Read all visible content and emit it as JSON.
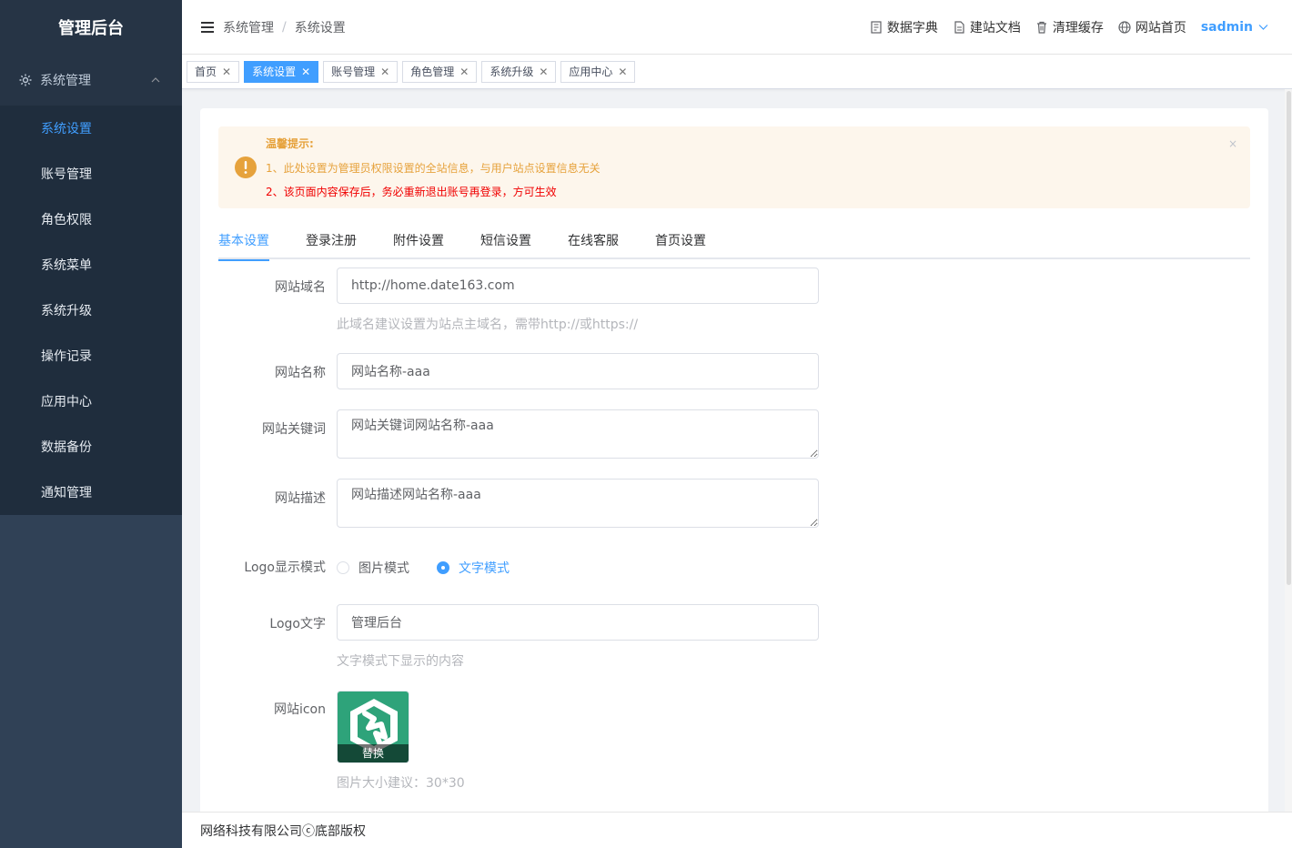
{
  "sidebar": {
    "logo": "管理后台",
    "group_label": "系统管理",
    "items": [
      {
        "label": "系统设置"
      },
      {
        "label": "账号管理"
      },
      {
        "label": "角色权限"
      },
      {
        "label": "系统菜单"
      },
      {
        "label": "系统升级"
      },
      {
        "label": "操作记录"
      },
      {
        "label": "应用中心"
      },
      {
        "label": "数据备份"
      },
      {
        "label": "通知管理"
      }
    ]
  },
  "header": {
    "breadcrumb": [
      "系统管理",
      "系统设置"
    ],
    "breadcrumb_sep": "/",
    "links": [
      {
        "label": "数据字典",
        "icon": "dictionary-icon"
      },
      {
        "label": "建站文档",
        "icon": "document-icon"
      },
      {
        "label": "清理缓存",
        "icon": "trash-icon"
      },
      {
        "label": "网站首页",
        "icon": "globe-icon"
      }
    ],
    "user": "sadmin"
  },
  "tags": [
    {
      "label": "首页"
    },
    {
      "label": "系统设置",
      "active": true
    },
    {
      "label": "账号管理"
    },
    {
      "label": "角色管理"
    },
    {
      "label": "系统升级"
    },
    {
      "label": "应用中心"
    }
  ],
  "alert": {
    "title": "温馨提示:",
    "line1": "1、此处设置为管理员权限设置的全站信息，与用户站点设置信息无关",
    "line2": "2、该页面内容保存后，务必重新退出账号再登录，方可生效",
    "close": "×"
  },
  "tabs": [
    {
      "label": "基本设置",
      "active": true
    },
    {
      "label": "登录注册"
    },
    {
      "label": "附件设置"
    },
    {
      "label": "短信设置"
    },
    {
      "label": "在线客服"
    },
    {
      "label": "首页设置"
    }
  ],
  "form": {
    "domain_label": "网站域名",
    "domain_value": "http://home.date163.com",
    "domain_hint": "此域名建议设置为站点主域名，需带http://或https://",
    "name_label": "网站名称",
    "name_value": "网站名称-aaa",
    "keywords_label": "网站关键词",
    "keywords_value": "网站关键词网站名称-aaa",
    "desc_label": "网站描述",
    "desc_value": "网站描述网站名称-aaa",
    "logo_mode_label": "Logo显示模式",
    "logo_mode_options": [
      "图片模式",
      "文字模式"
    ],
    "logo_mode_selected": "文字模式",
    "logo_text_label": "Logo文字",
    "logo_text_value": "管理后台",
    "logo_text_hint": "文字模式下显示的内容",
    "icon_label": "网站icon",
    "icon_replace": "替换",
    "icon_hint": "图片大小建议：30*30"
  },
  "footer": {
    "text": "网络科技有限公司ⓒ底部版权"
  },
  "colors": {
    "accent": "#409eff",
    "sidebar_bg": "#304156",
    "warning": "#e6a23c",
    "danger": "#f00000"
  }
}
